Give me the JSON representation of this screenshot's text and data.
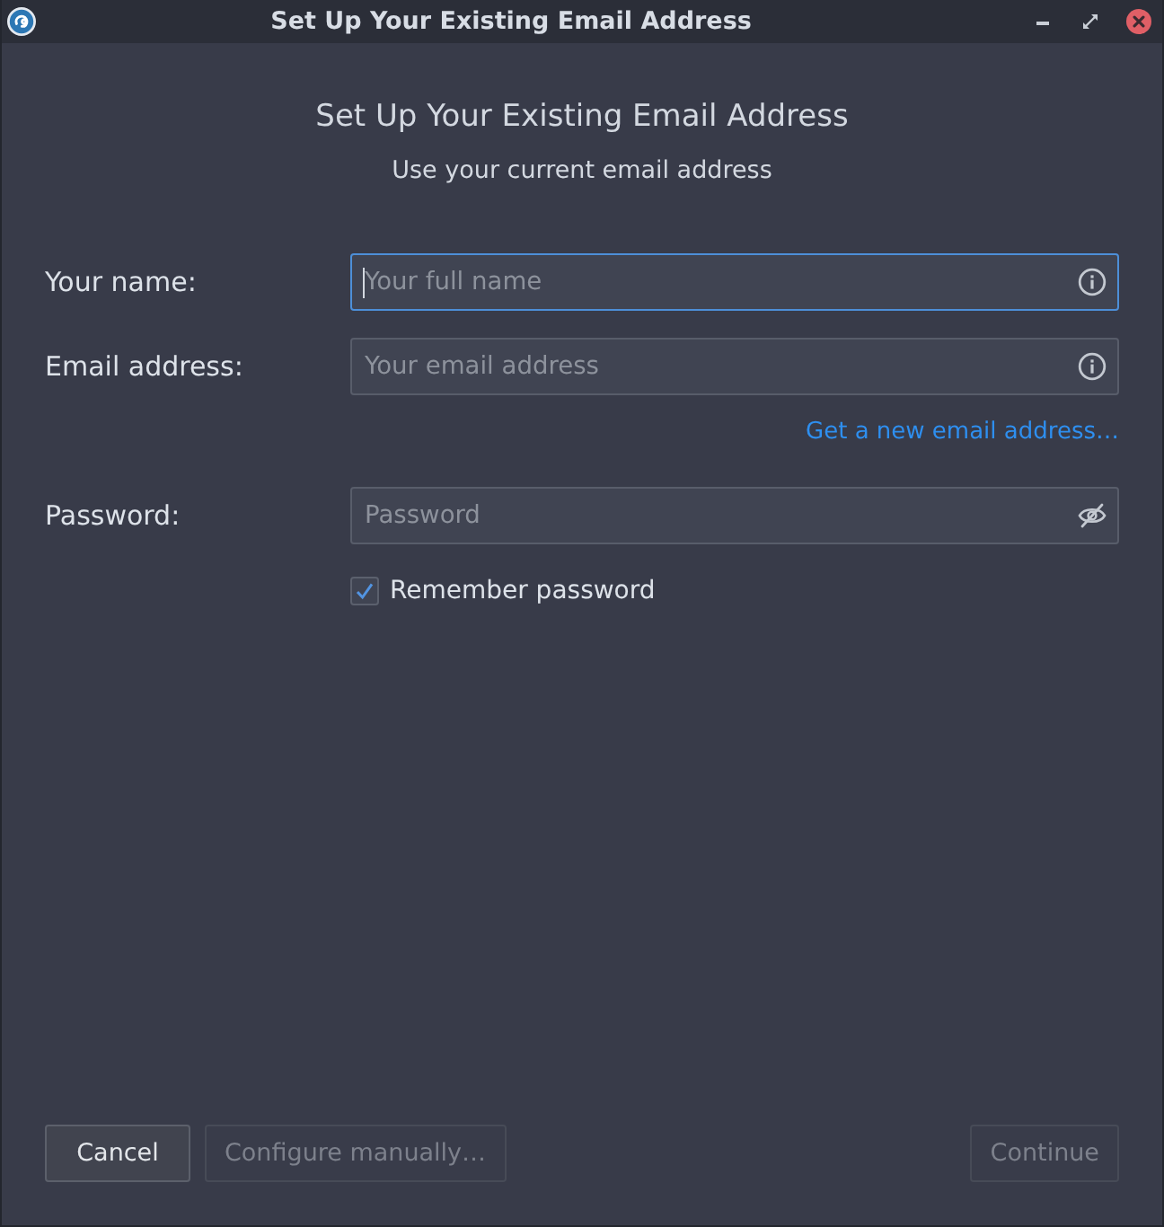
{
  "window": {
    "title": "Set Up Your Existing Email Address"
  },
  "header": {
    "title": "Set Up Your Existing Email Address",
    "subtitle": "Use your current email address"
  },
  "fields": [
    {
      "kind": "text",
      "label": "Your name:",
      "placeholder": "Your full name",
      "focused": true
    },
    {
      "kind": "email",
      "label": "Email address:",
      "placeholder": "Your email address",
      "focused": false,
      "link": {
        "label": "Get a new email address…"
      }
    },
    {
      "kind": "password",
      "label": "Password:",
      "placeholder": "Password",
      "focused": false
    }
  ],
  "remember_password": {
    "label": "Remember password",
    "checked": true
  },
  "buttons": [
    {
      "label": "Cancel",
      "disabled": false
    },
    {
      "label": "Configure manually…",
      "disabled": true
    },
    {
      "label": "Continue",
      "disabled": true
    }
  ]
}
